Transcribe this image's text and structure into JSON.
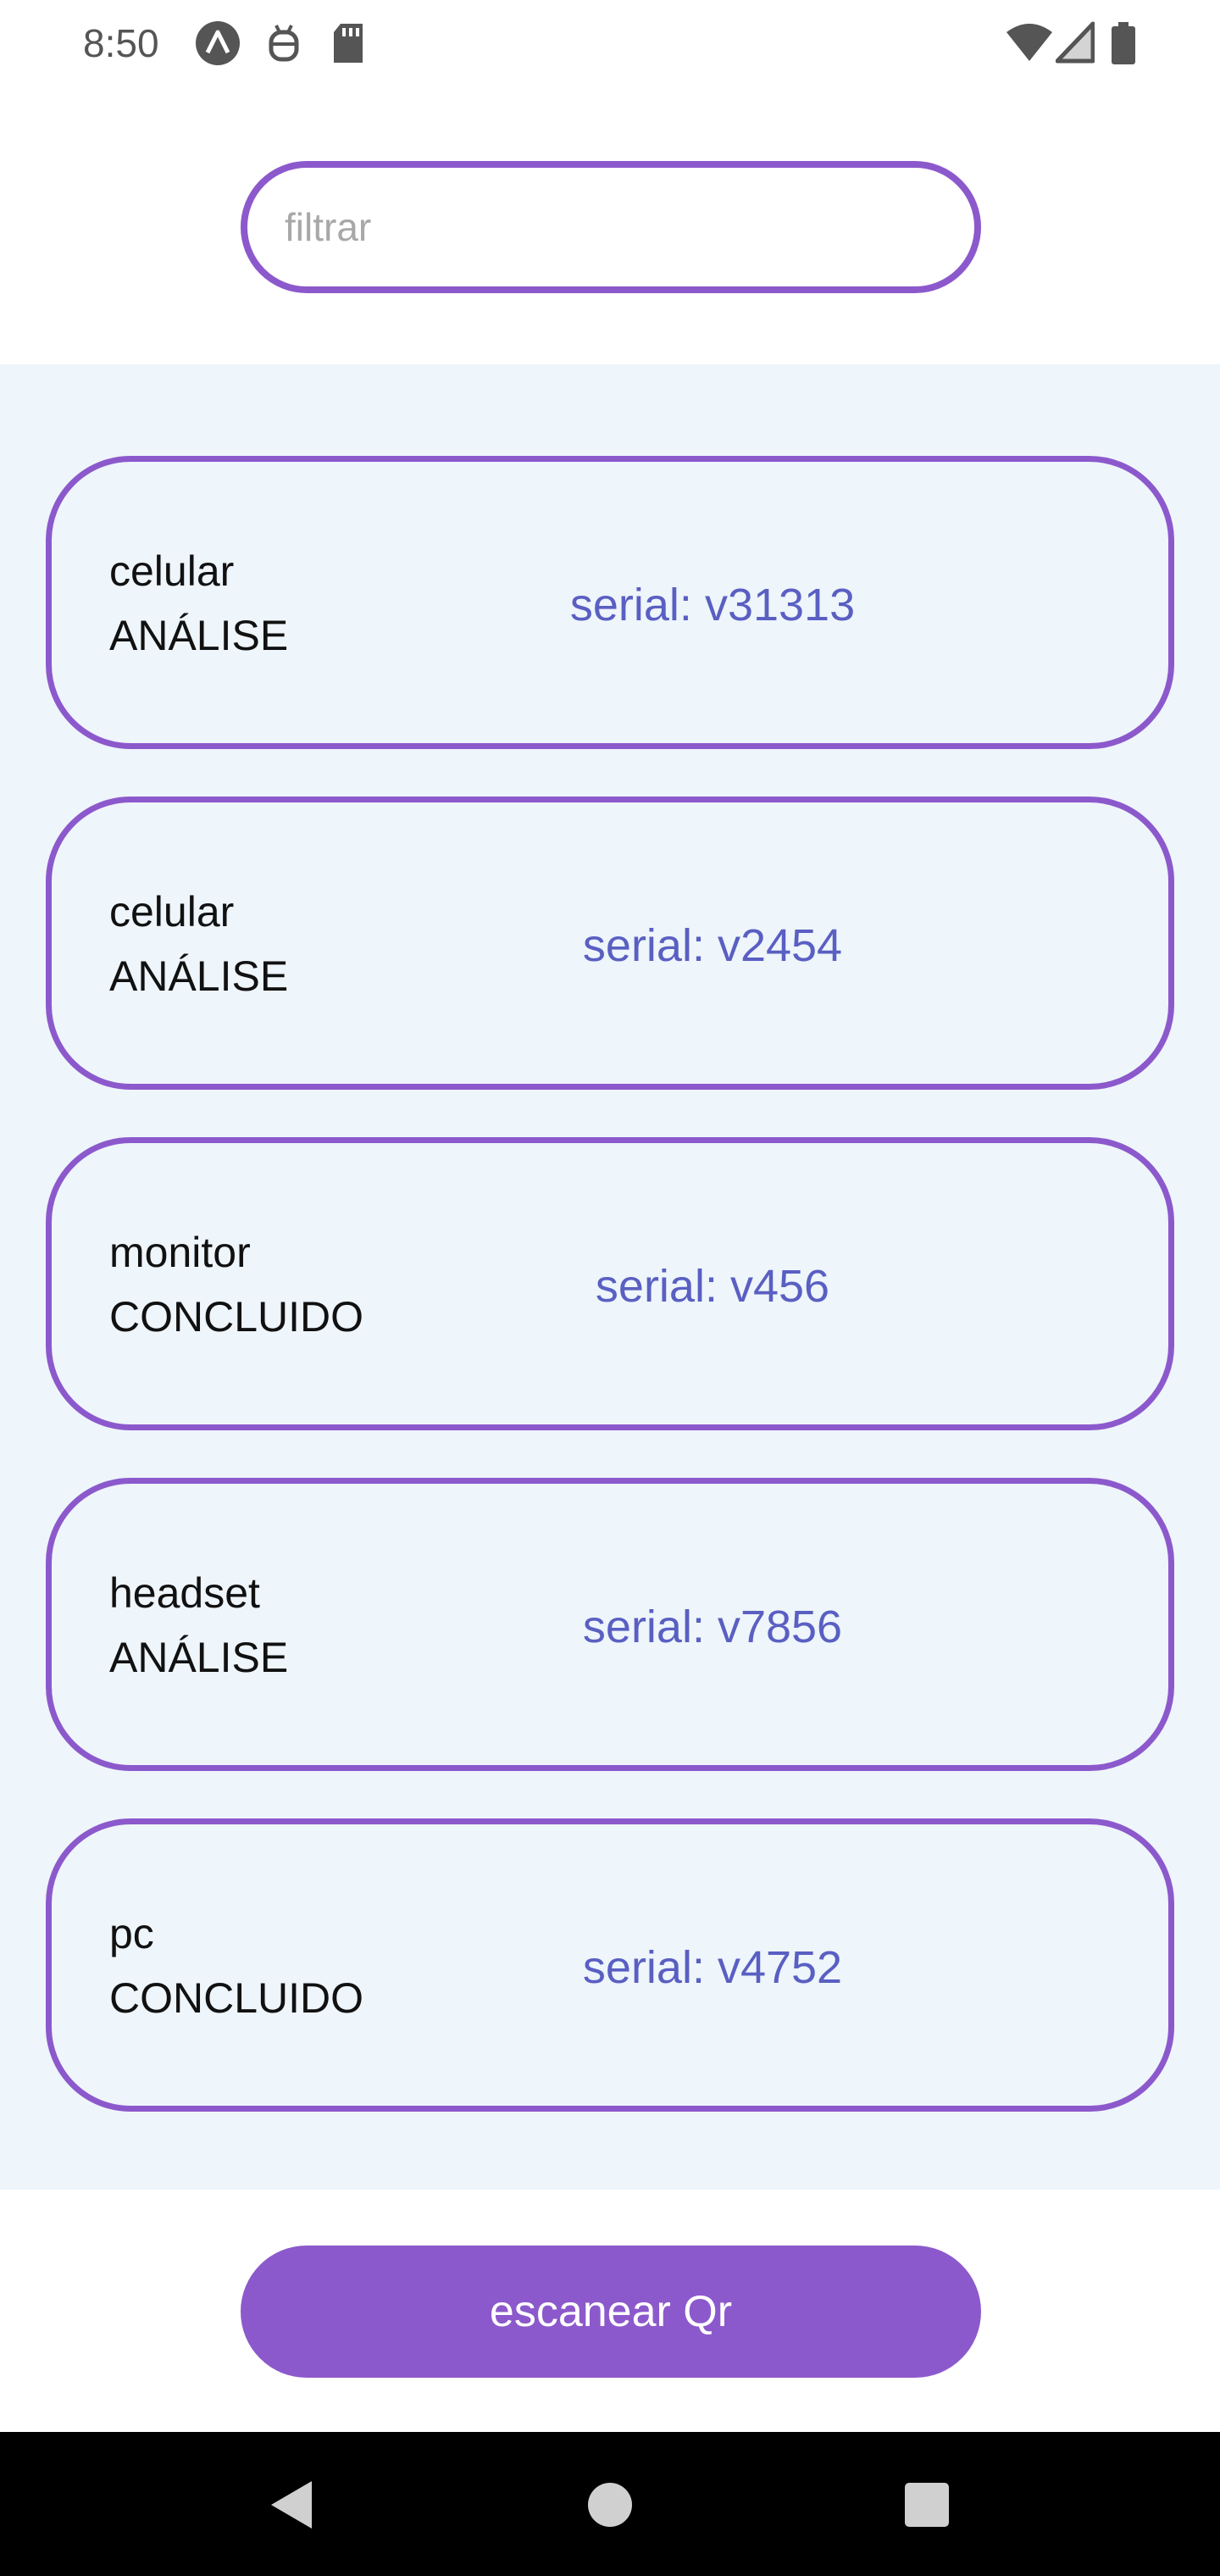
{
  "status_bar": {
    "time": "8:50",
    "left_icons": [
      "app-logo-icon",
      "debug-icon",
      "sd-card-icon"
    ],
    "right_icons": [
      "wifi-icon",
      "cell-signal-icon",
      "battery-icon"
    ]
  },
  "filter": {
    "placeholder": "filtrar",
    "value": ""
  },
  "items": [
    {
      "name": "celular",
      "status": "ANÁLISE",
      "serial": "serial: v31313"
    },
    {
      "name": "celular",
      "status": "ANÁLISE",
      "serial": "serial: v2454"
    },
    {
      "name": "monitor",
      "status": "CONCLUIDO",
      "serial": "serial: v456"
    },
    {
      "name": "headset",
      "status": "ANÁLISE",
      "serial": "serial: v7856"
    },
    {
      "name": "pc",
      "status": "CONCLUIDO",
      "serial": "serial: v4752"
    }
  ],
  "scan_button": {
    "label": "escanear Qr"
  },
  "nav": {
    "icons": [
      "back-icon",
      "home-icon",
      "recents-icon"
    ]
  },
  "colors": {
    "accent": "#8c59cc",
    "serial_text": "#5a5fc2",
    "list_background": "#eef5fb"
  }
}
